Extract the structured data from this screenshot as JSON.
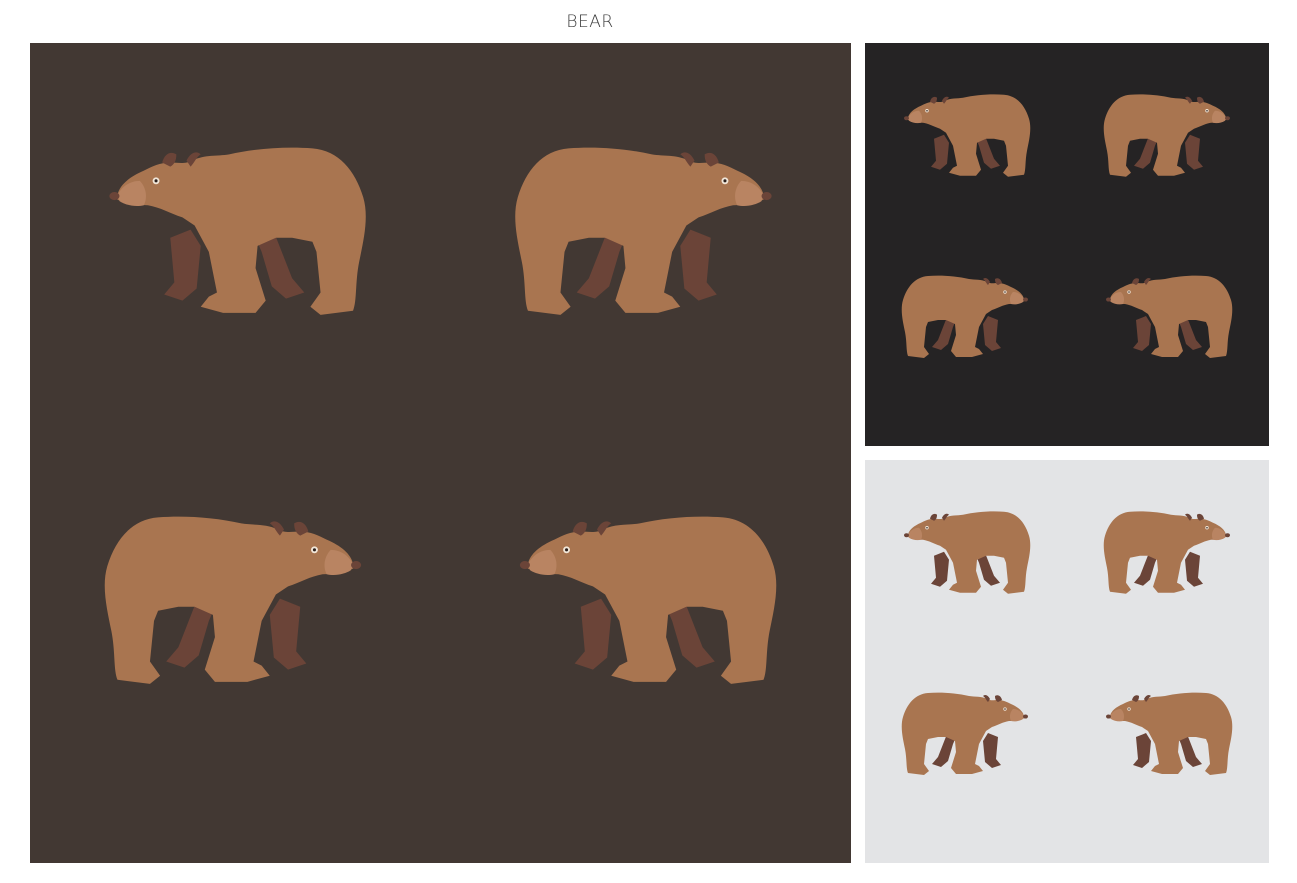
{
  "title": "BEAR",
  "colors": {
    "main_bg": "#423833",
    "dark_bg": "#252324",
    "light_bg": "#e3e4e6",
    "fur": "#a97550",
    "fur_dark": "#6b4438",
    "muzzle": "#b98462",
    "eye": "#f1e6d8"
  },
  "panels": [
    {
      "name": "main-pattern-panel",
      "bg": "main_bg",
      "bears": [
        "left-facing-bear",
        "right-facing-bear",
        "right-facing-bear",
        "left-facing-bear"
      ]
    },
    {
      "name": "dark-pattern-panel",
      "bg": "dark_bg",
      "bears": [
        "left-facing-bear",
        "right-facing-bear",
        "right-facing-bear",
        "left-facing-bear"
      ]
    },
    {
      "name": "light-pattern-panel",
      "bg": "light_bg",
      "bears": [
        "left-facing-bear",
        "right-facing-bear",
        "right-facing-bear",
        "left-facing-bear"
      ]
    }
  ]
}
